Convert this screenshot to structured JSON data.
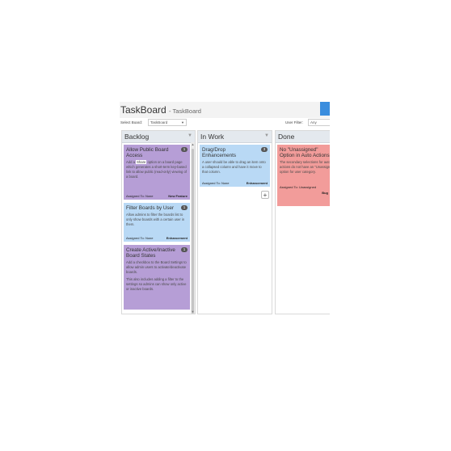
{
  "app": {
    "title": "TaskBoard",
    "subtitle": "- TaskBoard"
  },
  "filters": {
    "board_label": "Select Board:",
    "board_value": "TaskBoard",
    "user_label": "User Filter:",
    "user_value": "Any"
  },
  "columns": [
    {
      "title": "Backlog",
      "cards": [
        {
          "title": "Allow Public Board Access",
          "badge": "1",
          "desc_before": "Add a",
          "desc_highlight": "Share",
          "desc_after": "option on a board page which generates a short-term key-based link to allow public (read-only) viewing of a board.",
          "assignee": "Assigned To: None",
          "category": "New Feature",
          "color": "#b69ed6"
        },
        {
          "title": "Filter Boards by User",
          "badge": "1",
          "desc": "Allow admins to filter the boards list to only show boards with a certain user in them.",
          "assignee": "Assigned To: None",
          "category": "Enhancement",
          "color": "#b9d9f5"
        },
        {
          "title": "Create Active/Inactive Board States",
          "badge": "1",
          "desc": "Add a checkbox to the Board Settings to allow admin users to activate/deactivate boards.",
          "desc2": "This also includes adding a filter to the settings so admins can show only active or inactive boards.",
          "color": "#b69ed6"
        }
      ]
    },
    {
      "title": "In Work",
      "cards": [
        {
          "title": "Drag/Drop Enhancements",
          "badge": "3",
          "desc": "A user should be able to drag an item onto a collapsed column and have it move to that column.",
          "assignee": "Assigned To: None",
          "category": "Enhancement",
          "color": "#b9d9f5"
        }
      ],
      "add_label": "+"
    },
    {
      "title": "Done",
      "cards": [
        {
          "title": "No \"Unassigned\" Option in Auto Actions",
          "desc": "The secondary selections for automatic actions do not have an \"Unassigned\" option for user category.",
          "assignee": "Assigned To: Unassigned",
          "category": "Bug",
          "color": "#f29c9a"
        }
      ]
    }
  ],
  "colors": {
    "accent": "#3a8dde",
    "column_header": "#e4e9ee",
    "purple": "#b69ed6",
    "blue": "#b9d9f5",
    "red": "#f29c9a"
  },
  "icons": {
    "collapse": "chevron-down-icon",
    "add": "plus-icon"
  }
}
